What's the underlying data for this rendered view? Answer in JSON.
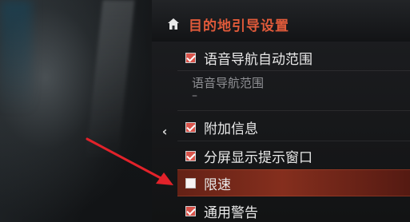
{
  "header": {
    "title": "目的地引导设置",
    "home_icon": "home-icon"
  },
  "nav": {
    "back_icon": "chevron-left-icon",
    "back_glyph": "‹"
  },
  "settings": {
    "voice_nav_auto_range": {
      "label": "语音导航自动范围",
      "checked": true
    },
    "voice_nav_range": {
      "label": "语音导航范围",
      "value": "–"
    },
    "additional_info": {
      "label": "附加信息",
      "checked": true
    },
    "split_screen_window": {
      "label": "分屏显示提示窗口",
      "checked": true
    },
    "speed_limit": {
      "label": "限速",
      "checked": false
    },
    "general_warning": {
      "label": "通用警告",
      "checked": true
    }
  },
  "colors": {
    "accent_title": "#e05a3a",
    "selected_row": "#8b301e",
    "checkbox_checked": "#d9534a",
    "annotation_arrow": "#e2222a"
  }
}
